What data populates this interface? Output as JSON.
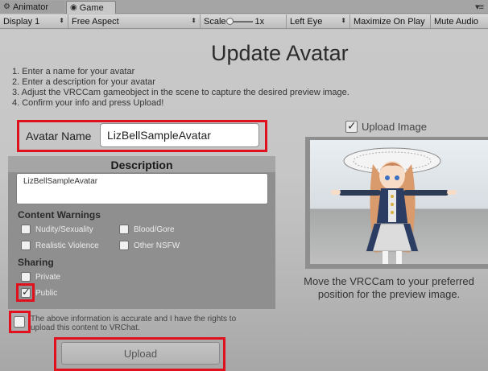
{
  "tabs": [
    {
      "label": "Animator",
      "icon": "animator-icon",
      "active": false
    },
    {
      "label": "Game",
      "icon": "game-icon",
      "active": true
    }
  ],
  "toolbar": {
    "display": "Display 1",
    "aspect": "Free Aspect",
    "scale_label": "Scale",
    "scale_value": "1x",
    "eye": "Left Eye",
    "maximize": "Maximize On Play",
    "mute": "Mute Audio"
  },
  "page": {
    "title": "Update Avatar",
    "instructions": [
      "1. Enter a name for your avatar",
      "2. Enter a description for your avatar",
      "3. Adjust the VRCCam gameobject in the scene to capture the desired preview image.",
      "4. Confirm your info and press Upload!"
    ]
  },
  "form": {
    "name_label": "Avatar Name",
    "name_value": "LizBellSampleAvatar",
    "description_heading": "Description",
    "description_value": "LizBellSampleAvatar",
    "content_warnings_heading": "Content Warnings",
    "content_warnings": [
      {
        "label": "Nudity/Sexuality",
        "checked": false
      },
      {
        "label": "Blood/Gore",
        "checked": false
      },
      {
        "label": "Realistic Violence",
        "checked": false
      },
      {
        "label": "Other NSFW",
        "checked": false
      }
    ],
    "sharing_heading": "Sharing",
    "sharing": [
      {
        "label": "Private",
        "checked": false
      },
      {
        "label": "Public",
        "checked": true
      }
    ],
    "terms_text": "The above information is accurate and I have the rights to upload this content to VRChat.",
    "terms_checked": false,
    "upload_button": "Upload"
  },
  "preview": {
    "upload_image_label": "Upload Image",
    "upload_image_checked": true,
    "caption": "Move the VRCCam to your preferred position for the preview image."
  },
  "colors": {
    "highlight": "#e0101c",
    "panel": "#8f8f8f"
  }
}
